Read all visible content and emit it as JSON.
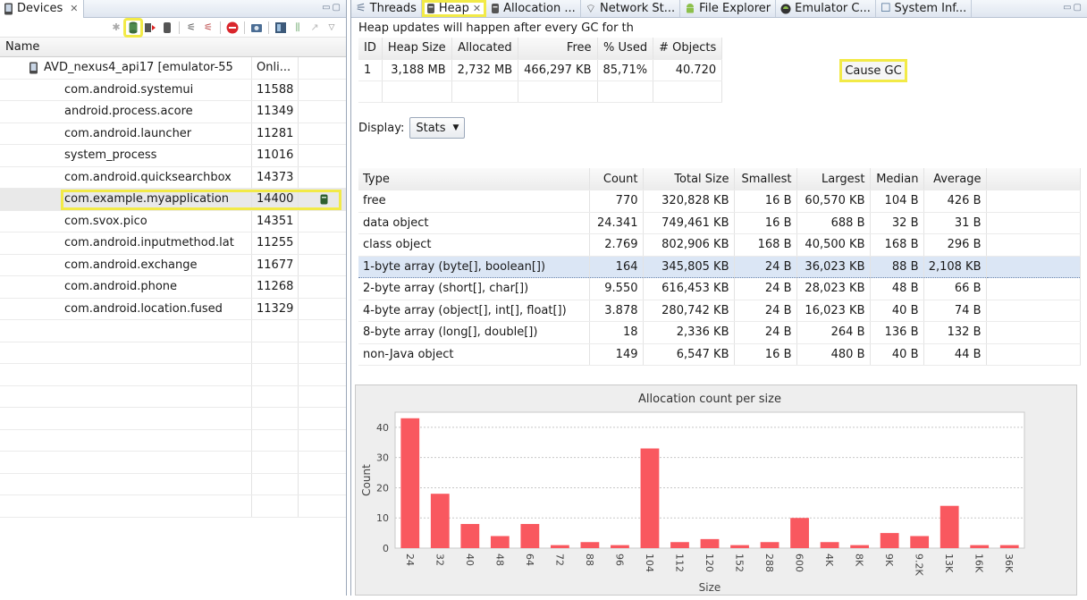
{
  "devices_view": {
    "tab_label": "Devices",
    "column_name": "Name",
    "device": {
      "name": "AVD_nexus4_api17 [emulator-55",
      "status": "Onli..."
    },
    "processes": [
      {
        "name": "com.android.systemui",
        "pid": "11588"
      },
      {
        "name": "android.process.acore",
        "pid": "11349"
      },
      {
        "name": "com.android.launcher",
        "pid": "11281"
      },
      {
        "name": "system_process",
        "pid": "11016"
      },
      {
        "name": "com.android.quicksearchbox",
        "pid": "14373"
      },
      {
        "name": "com.example.myapplication",
        "pid": "14400"
      },
      {
        "name": "com.svox.pico",
        "pid": "14351"
      },
      {
        "name": "com.android.inputmethod.lat",
        "pid": "11255"
      },
      {
        "name": "com.android.exchange",
        "pid": "11677"
      },
      {
        "name": "com.android.phone",
        "pid": "11268"
      },
      {
        "name": "com.android.location.fused",
        "pid": "11329"
      }
    ],
    "selected_index": 5
  },
  "tabs": [
    {
      "label": "Threads",
      "icon": "threads-icon"
    },
    {
      "label": "Heap",
      "icon": "heap-icon",
      "active": true
    },
    {
      "label": "Allocation ...",
      "icon": "allocation-icon"
    },
    {
      "label": "Network St...",
      "icon": "network-icon"
    },
    {
      "label": "File Explorer",
      "icon": "android-icon"
    },
    {
      "label": "Emulator C...",
      "icon": "emulator-icon"
    },
    {
      "label": "System Inf...",
      "icon": "system-info-icon"
    }
  ],
  "heap": {
    "note": "Heap updates will happen after every GC for th",
    "summary": {
      "headers": [
        "ID",
        "Heap Size",
        "Allocated",
        "Free",
        "% Used",
        "# Objects"
      ],
      "row": [
        "1",
        "3,188 MB",
        "2,732 MB",
        "466,297 KB",
        "85,71%",
        "40.720"
      ]
    },
    "cause_gc_label": "Cause GC",
    "display_label": "Display:",
    "display_value": "Stats",
    "stats": {
      "headers": [
        "Type",
        "Count",
        "Total Size",
        "Smallest",
        "Largest",
        "Median",
        "Average"
      ],
      "rows": [
        [
          "free",
          "770",
          "320,828 KB",
          "16 B",
          "60,570 KB",
          "104 B",
          "426 B"
        ],
        [
          "data object",
          "24.341",
          "749,461 KB",
          "16 B",
          "688 B",
          "32 B",
          "31 B"
        ],
        [
          "class object",
          "2.769",
          "802,906 KB",
          "168 B",
          "40,500 KB",
          "168 B",
          "296 B"
        ],
        [
          "1-byte array (byte[], boolean[])",
          "164",
          "345,805 KB",
          "24 B",
          "36,023 KB",
          "88 B",
          "2,108 KB"
        ],
        [
          "2-byte array (short[], char[])",
          "9.550",
          "616,453 KB",
          "24 B",
          "28,023 KB",
          "48 B",
          "66 B"
        ],
        [
          "4-byte array (object[], int[], float[])",
          "3.878",
          "280,742 KB",
          "24 B",
          "16,023 KB",
          "40 B",
          "74 B"
        ],
        [
          "8-byte array (long[], double[])",
          "18",
          "2,336 KB",
          "24 B",
          "264 B",
          "136 B",
          "132 B"
        ],
        [
          "non-Java object",
          "149",
          "6,547 KB",
          "16 B",
          "480 B",
          "40 B",
          "44 B"
        ]
      ],
      "selected_index": 3
    }
  },
  "chart_data": {
    "type": "bar",
    "title": "Allocation count per size",
    "xlabel": "Size",
    "ylabel": "Count",
    "ylim": [
      0,
      45
    ],
    "yticks": [
      0,
      10,
      20,
      30,
      40
    ],
    "grid": true,
    "bar_color": "#f9585f",
    "categories": [
      "24",
      "32",
      "40",
      "48",
      "64",
      "72",
      "88",
      "96",
      "104",
      "112",
      "120",
      "152",
      "288",
      "600",
      "4K",
      "8K",
      "9K",
      "9.2K",
      "13K",
      "16K",
      "36K"
    ],
    "values": [
      43,
      18,
      8,
      4,
      8,
      1,
      2,
      1,
      33,
      2,
      3,
      1,
      2,
      10,
      2,
      1,
      5,
      4,
      14,
      1,
      1
    ]
  },
  "colors": {
    "highlight": "#f2ea47",
    "selection": "#dbe6f5",
    "bar": "#f9585f"
  }
}
